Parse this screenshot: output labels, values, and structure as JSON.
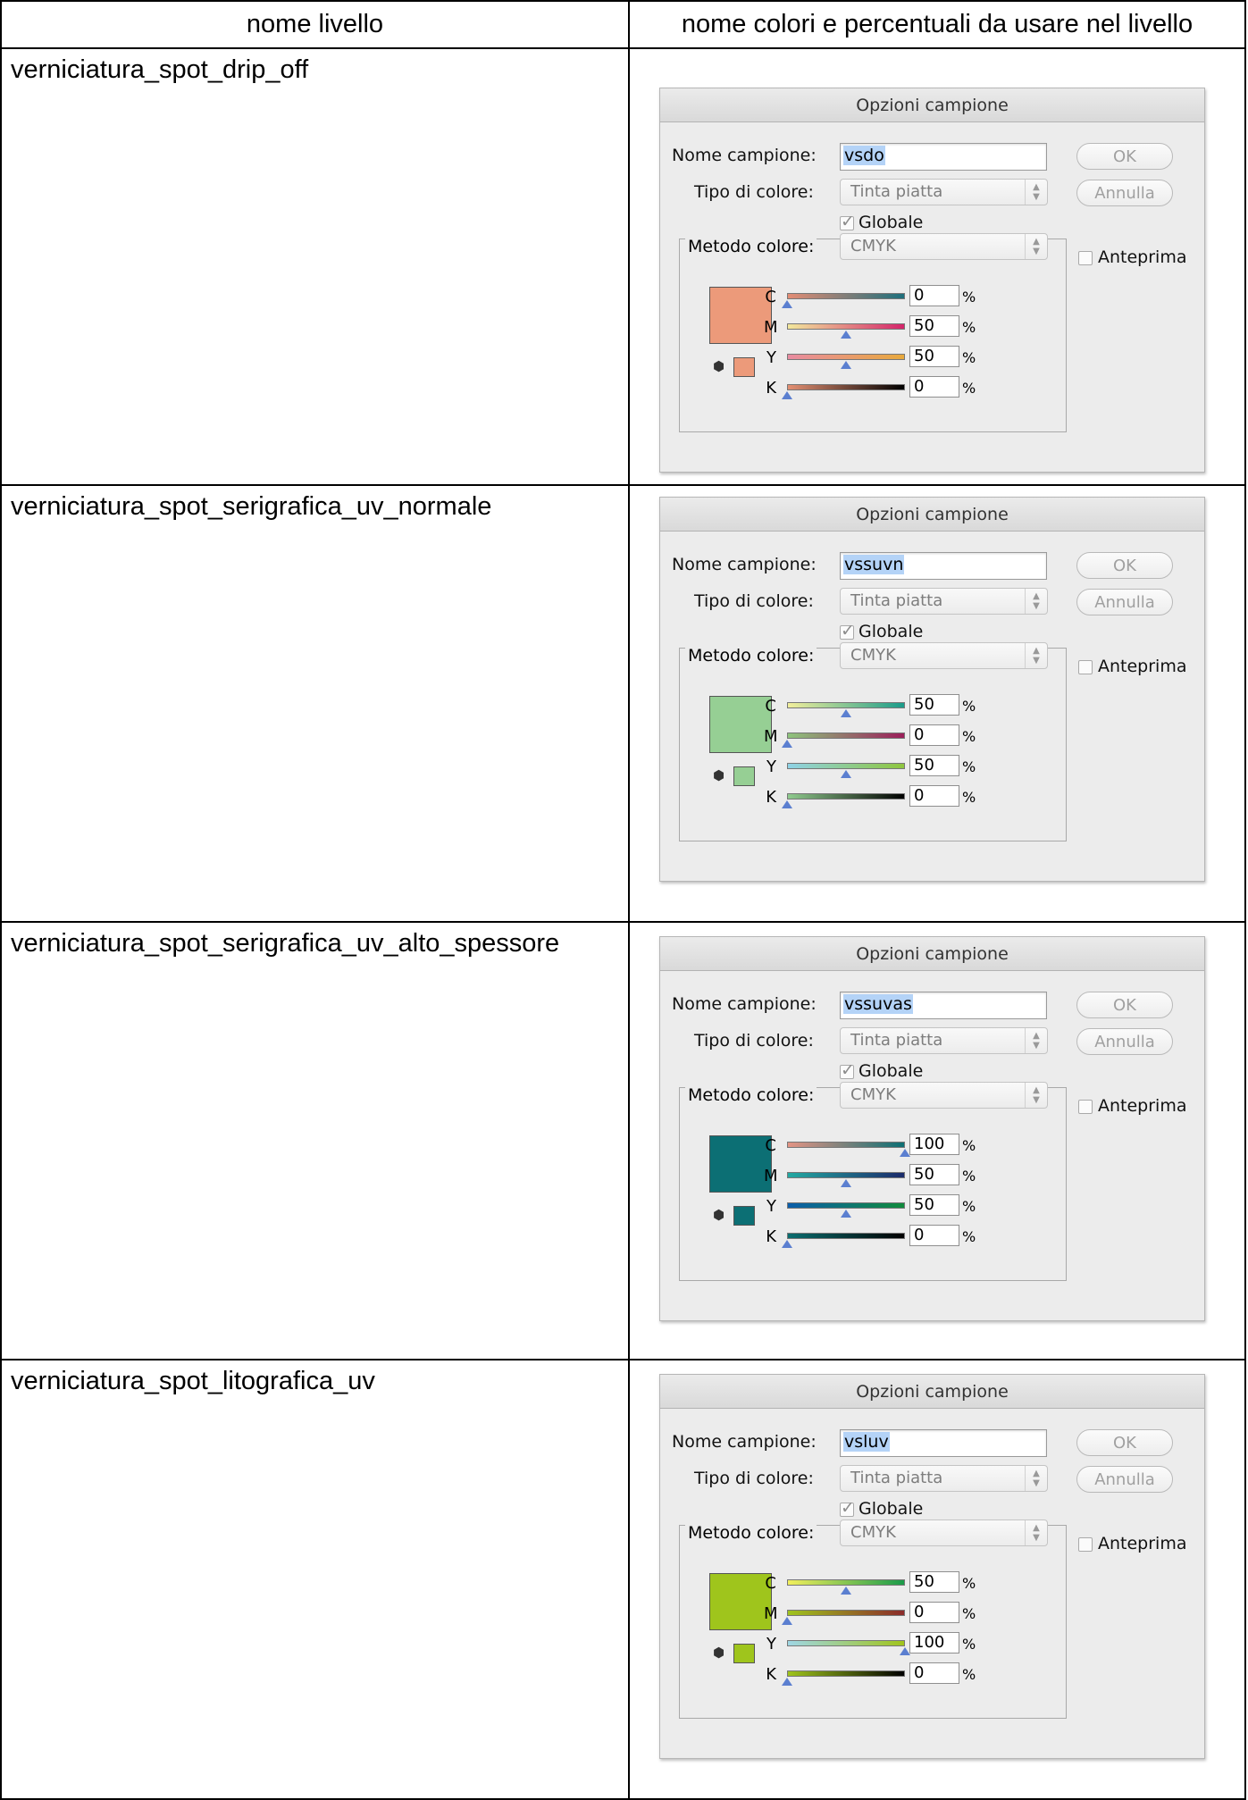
{
  "table": {
    "header_left": "nome livello",
    "header_right": "nome colori e percentuali da usare nel livello"
  },
  "dialog_labels": {
    "title": "Opzioni campione",
    "nome_campione": "Nome campione:",
    "tipo_colore": "Tipo di colore:",
    "tipo_colore_value": "Tinta piatta",
    "globale": "Globale",
    "metodo_colore": "Metodo colore:",
    "metodo_colore_value": "CMYK",
    "anteprima": "Anteprima",
    "ok": "OK",
    "annulla": "Annulla",
    "pct": "%"
  },
  "rows": [
    {
      "layer_name": "verniciatura_spot_drip_off",
      "swatch_name": "vsdo",
      "swatch_color": "#ec9a7a",
      "channels": [
        {
          "label": "C",
          "value": "0",
          "thumb_frac": 0.0,
          "gradient": [
            "#e38c74",
            "#1e6f7c"
          ]
        },
        {
          "label": "M",
          "value": "50",
          "thumb_frac": 0.5,
          "gradient": [
            "#f2e89c",
            "#d4246a"
          ]
        },
        {
          "label": "Y",
          "value": "50",
          "thumb_frac": 0.5,
          "gradient": [
            "#e88ba1",
            "#e8a93c"
          ]
        },
        {
          "label": "K",
          "value": "0",
          "thumb_frac": 0.0,
          "gradient": [
            "#e38f72",
            "#000000"
          ]
        }
      ]
    },
    {
      "layer_name": "verniciatura_spot_serigrafica_uv_normale",
      "swatch_name": "vssuvn",
      "swatch_color": "#96cf94",
      "channels": [
        {
          "label": "C",
          "value": "50",
          "thumb_frac": 0.5,
          "gradient": [
            "#f2ef9c",
            "#1a9b8a"
          ]
        },
        {
          "label": "M",
          "value": "0",
          "thumb_frac": 0.0,
          "gradient": [
            "#8ec47c",
            "#9b1e5a"
          ]
        },
        {
          "label": "Y",
          "value": "50",
          "thumb_frac": 0.5,
          "gradient": [
            "#8fd2e6",
            "#8fc63e"
          ]
        },
        {
          "label": "K",
          "value": "0",
          "thumb_frac": 0.0,
          "gradient": [
            "#8fcb8e",
            "#000000"
          ]
        }
      ]
    },
    {
      "layer_name": "verniciatura_spot_serigrafica_uv_alto_spessore",
      "swatch_name": "vssuvas",
      "swatch_color": "#0c6f74",
      "channels": [
        {
          "label": "C",
          "value": "100",
          "thumb_frac": 1.0,
          "gradient": [
            "#e49484",
            "#0c6f74"
          ]
        },
        {
          "label": "M",
          "value": "50",
          "thumb_frac": 0.5,
          "gradient": [
            "#23a9a2",
            "#1b2a6a"
          ]
        },
        {
          "label": "Y",
          "value": "50",
          "thumb_frac": 0.5,
          "gradient": [
            "#0b5eab",
            "#108b3c"
          ]
        },
        {
          "label": "K",
          "value": "0",
          "thumb_frac": 0.0,
          "gradient": [
            "#0b6d70",
            "#000000"
          ]
        }
      ]
    },
    {
      "layer_name": "verniciatura_spot_litografica_uv",
      "swatch_name": "vsluv",
      "swatch_color": "#9fc51c",
      "channels": [
        {
          "label": "C",
          "value": "50",
          "thumb_frac": 0.5,
          "gradient": [
            "#f2ef5c",
            "#1a9b4a"
          ]
        },
        {
          "label": "M",
          "value": "0",
          "thumb_frac": 0.0,
          "gradient": [
            "#9fc41e",
            "#8b2a2a"
          ]
        },
        {
          "label": "Y",
          "value": "100",
          "thumb_frac": 1.0,
          "gradient": [
            "#9fd6e4",
            "#a0c41c"
          ]
        },
        {
          "label": "K",
          "value": "0",
          "thumb_frac": 0.0,
          "gradient": [
            "#9fc41c",
            "#000000"
          ]
        }
      ]
    }
  ]
}
